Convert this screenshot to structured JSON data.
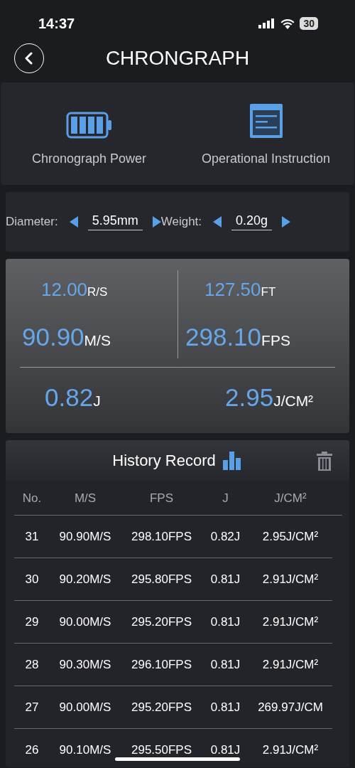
{
  "status_bar": {
    "time": "14:37",
    "battery": "30"
  },
  "header": {
    "title": "CHRONGRAPH"
  },
  "shortcuts": [
    {
      "kind": "battery",
      "label": "Chronograph Power"
    },
    {
      "kind": "document",
      "label": "Operational Instruction"
    }
  ],
  "params": [
    {
      "label": "Diameter:",
      "value": "5.95mm"
    },
    {
      "label": "Weight:",
      "value": "0.20g"
    }
  ],
  "readings": {
    "top": [
      {
        "value": "12.00",
        "unit": "R/S",
        "kind": "secondary"
      },
      {
        "value": "127.50",
        "unit": "FT",
        "kind": "secondary"
      },
      {
        "value": "90.90",
        "unit": "M/S",
        "kind": "primary"
      },
      {
        "value": "298.10",
        "unit": "FPS",
        "kind": "primary"
      }
    ],
    "bottom": [
      {
        "value": "0.82",
        "unit": "J"
      },
      {
        "value": "2.95",
        "unit": "J/CM²"
      }
    ]
  },
  "history": {
    "title": "History Record",
    "columns": [
      "No.",
      "M/S",
      "FPS",
      "J",
      "J/CM²"
    ],
    "rows": [
      [
        "31",
        "90.90M/S",
        "298.10FPS",
        "0.82J",
        "2.95J/CM²"
      ],
      [
        "30",
        "90.20M/S",
        "295.80FPS",
        "0.81J",
        "2.91J/CM²"
      ],
      [
        "29",
        "90.00M/S",
        "295.20FPS",
        "0.81J",
        "2.91J/CM²"
      ],
      [
        "28",
        "90.30M/S",
        "296.10FPS",
        "0.81J",
        "2.91J/CM²"
      ],
      [
        "27",
        "90.00M/S",
        "295.20FPS",
        "0.81J",
        "269.97J/CM"
      ],
      [
        "26",
        "90.10M/S",
        "295.50FPS",
        "0.81J",
        "2.91J/CM²"
      ]
    ]
  }
}
